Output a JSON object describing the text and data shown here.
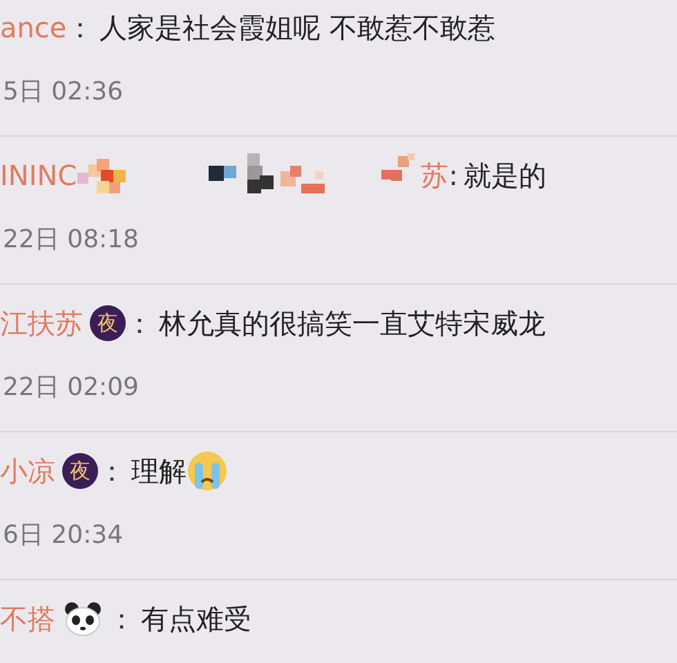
{
  "comments": [
    {
      "name": "ance",
      "separator": "：",
      "text": "人家是社会霞姐呢 不敢惹不敢惹",
      "time": "5日 02:36"
    },
    {
      "name": "ININC",
      "censored": true,
      "name_end": "苏",
      "separator": ":",
      "text": "就是的",
      "time": "22日 08:18"
    },
    {
      "name": "江扶苏",
      "badge": {
        "kind": "night",
        "text": "夜"
      },
      "separator": "：",
      "text": "林允真的很搞笑一直艾特宋威龙",
      "time": "22日 02:09"
    },
    {
      "name": "小凉",
      "badge": {
        "kind": "night",
        "text": "夜"
      },
      "separator": "：",
      "text": "理解",
      "emoji": {
        "kind": "crying"
      },
      "time": "6日 20:34"
    },
    {
      "name": "不搭",
      "badge": {
        "kind": "panda"
      },
      "separator": "：",
      "text": "有点难受"
    }
  ]
}
